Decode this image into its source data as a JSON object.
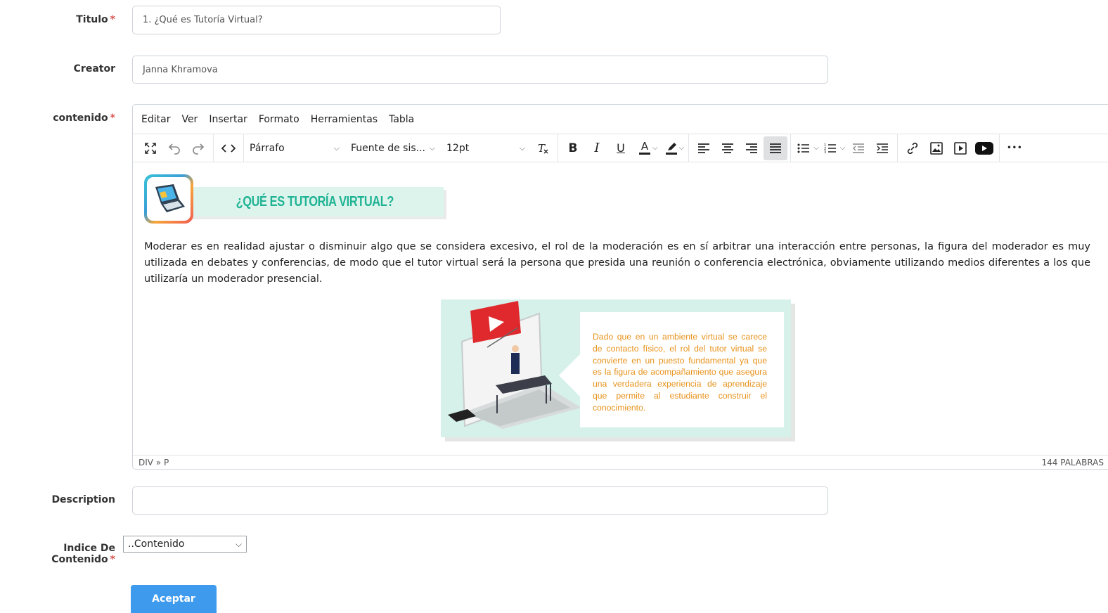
{
  "form": {
    "title_label": "Titulo",
    "title_value": "1. ¿Qué es Tutoría Virtual?",
    "creator_label": "Creator",
    "creator_value": "Janna Khramova",
    "content_label": "contenido",
    "description_label": "Description",
    "description_value": "",
    "index_label": "Indice De Contenido",
    "index_value": "..Contenido",
    "required_mark": "*",
    "submit_label": "Aceptar"
  },
  "editor": {
    "menu": [
      "Editar",
      "Ver",
      "Insertar",
      "Formato",
      "Herramientas",
      "Tabla"
    ],
    "block_format": "Párrafo",
    "font_family": "Fuente de sis...",
    "font_size": "12pt",
    "bold": "B",
    "italic": "I",
    "underline": "U",
    "font_color": "A",
    "more": "•••",
    "heading_text": "¿QUÉ ES TUTORÍA VIRTUAL?",
    "paragraph": "Moderar es en realidad ajustar o disminuir algo que se considera excesivo, el rol de la moderación es en sí arbitrar una interacción entre personas, la figura del moderador es muy utilizada en debates y conferencias, de modo que el tutor virtual será la persona que presida una reunión o conferencia electrónica, obviamente utilizando medios diferentes a los que utilizaría un moderador presencial.",
    "image_text": "Dado que en un ambiente virtual se carece de contacto físico, el rol del tutor virtual se convierte en un puesto fundamental ya que es la figura de acompañamiento que asegura una verdadera experiencia de aprendizaje que permite al estudiante construir el conocimiento.",
    "status_path": "DIV » P",
    "word_count": "144 PALABRAS"
  },
  "colors": {
    "required": "#d9534f",
    "accent": "#3d9aed",
    "banner_text": "#1fb394",
    "banner_bg": "#ddf4ec",
    "illus_text": "#e7921b"
  }
}
